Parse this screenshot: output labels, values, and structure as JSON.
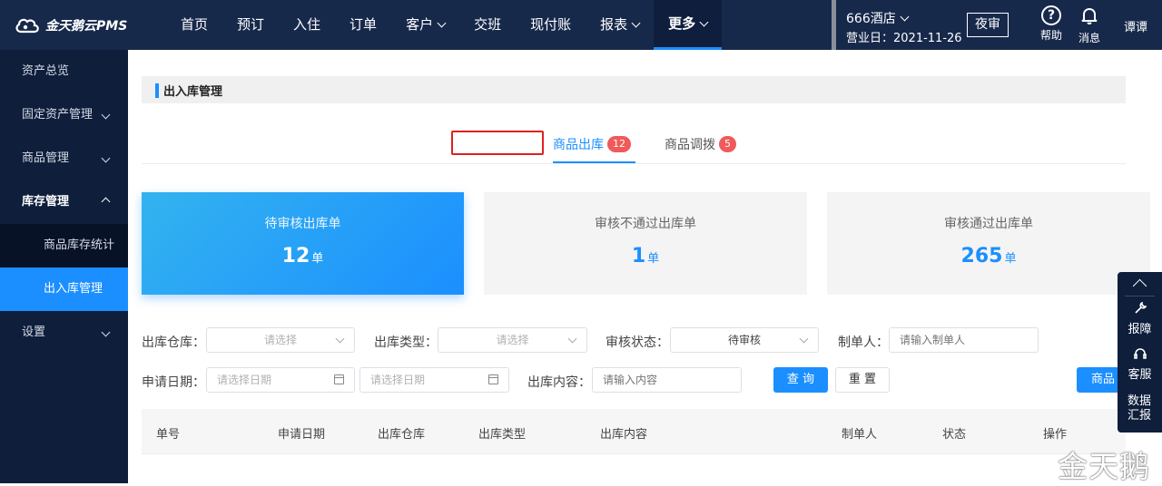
{
  "brand": {
    "logo_text": "金天鹅云PMS"
  },
  "nav": {
    "items": [
      {
        "label": "首页"
      },
      {
        "label": "预订"
      },
      {
        "label": "入住"
      },
      {
        "label": "订单"
      },
      {
        "label": "客户"
      },
      {
        "label": "交班"
      },
      {
        "label": "现付账"
      },
      {
        "label": "报表"
      },
      {
        "label": "更多"
      }
    ]
  },
  "topbar": {
    "hotel": "666酒店",
    "business_date": "营业日：2021-11-26",
    "night_audit": "夜审",
    "help": "帮助",
    "messages": "消息",
    "user": "谭谭"
  },
  "sidebar": {
    "items": [
      {
        "label": "资产总览"
      },
      {
        "label": "固定资产管理"
      },
      {
        "label": "商品管理"
      },
      {
        "label": "库存管理"
      },
      {
        "label": "商品库存统计"
      },
      {
        "label": "出入库管理"
      },
      {
        "label": "设置"
      }
    ]
  },
  "page": {
    "title": "出入库管理"
  },
  "tabs": [
    {
      "label": "商品出库",
      "badge": "12"
    },
    {
      "label": "商品调拨",
      "badge": "5"
    }
  ],
  "cards": [
    {
      "label": "待审核出库单",
      "value": "12",
      "unit": "单"
    },
    {
      "label": "审核不通过出库单",
      "value": "1",
      "unit": "单"
    },
    {
      "label": "审核通过出库单",
      "value": "265",
      "unit": "单"
    }
  ],
  "filters": {
    "warehouse": {
      "label": "出库仓库：",
      "placeholder": "请选择"
    },
    "type": {
      "label": "出库类型：",
      "placeholder": "请选择"
    },
    "status": {
      "label": "审核状态：",
      "value": "待审核"
    },
    "creator": {
      "label": "制单人：",
      "placeholder": "请输入制单人"
    },
    "date": {
      "label": "申请日期：",
      "start_placeholder": "请选择日期",
      "end_placeholder": "请选择日期"
    },
    "content": {
      "label": "出库内容：",
      "placeholder": "请输入内容"
    },
    "query": "查 询",
    "reset": "重 置",
    "goods_button": "商品"
  },
  "table": {
    "columns": [
      "单号",
      "申请日期",
      "出库仓库",
      "出库类型",
      "出库内容",
      "制单人",
      "状态",
      "操作"
    ]
  },
  "float_panel": {
    "report": "报障",
    "service": "客服",
    "data_report": "数据汇报"
  },
  "watermark": "金天鹅"
}
